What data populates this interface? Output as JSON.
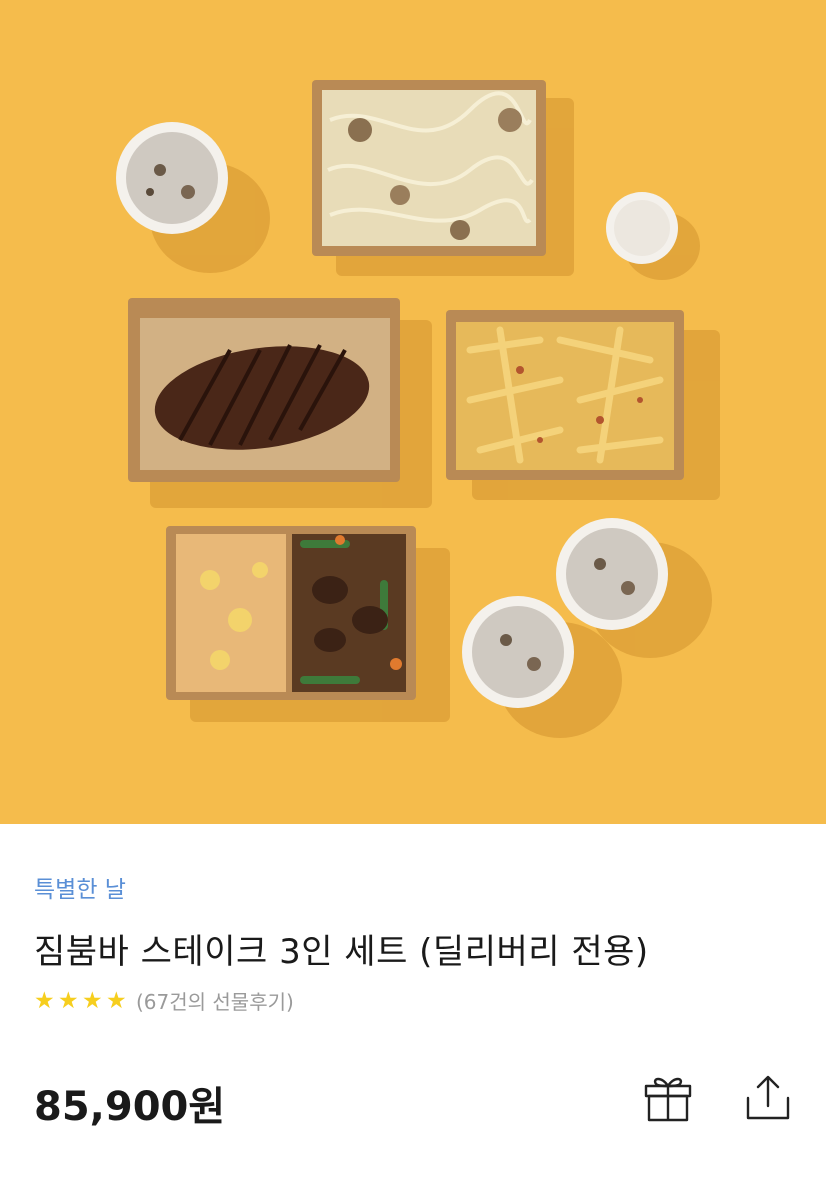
{
  "product": {
    "image_alt": "짐붐바 스테이크 3인 세트 food spread",
    "category": "특별한 날",
    "title": "짐붐바 스테이크 3인 세트 (딜리버리 전용)",
    "rating_stars": 4,
    "review_text": "(67건의 선물후기)",
    "price": "85,900원"
  },
  "actions": {
    "gift_icon": "gift-icon",
    "share_icon": "share-icon"
  },
  "colors": {
    "hero_background": "#F5BC4C",
    "category": "#5A8FD6",
    "star": "#F6CE1E"
  }
}
